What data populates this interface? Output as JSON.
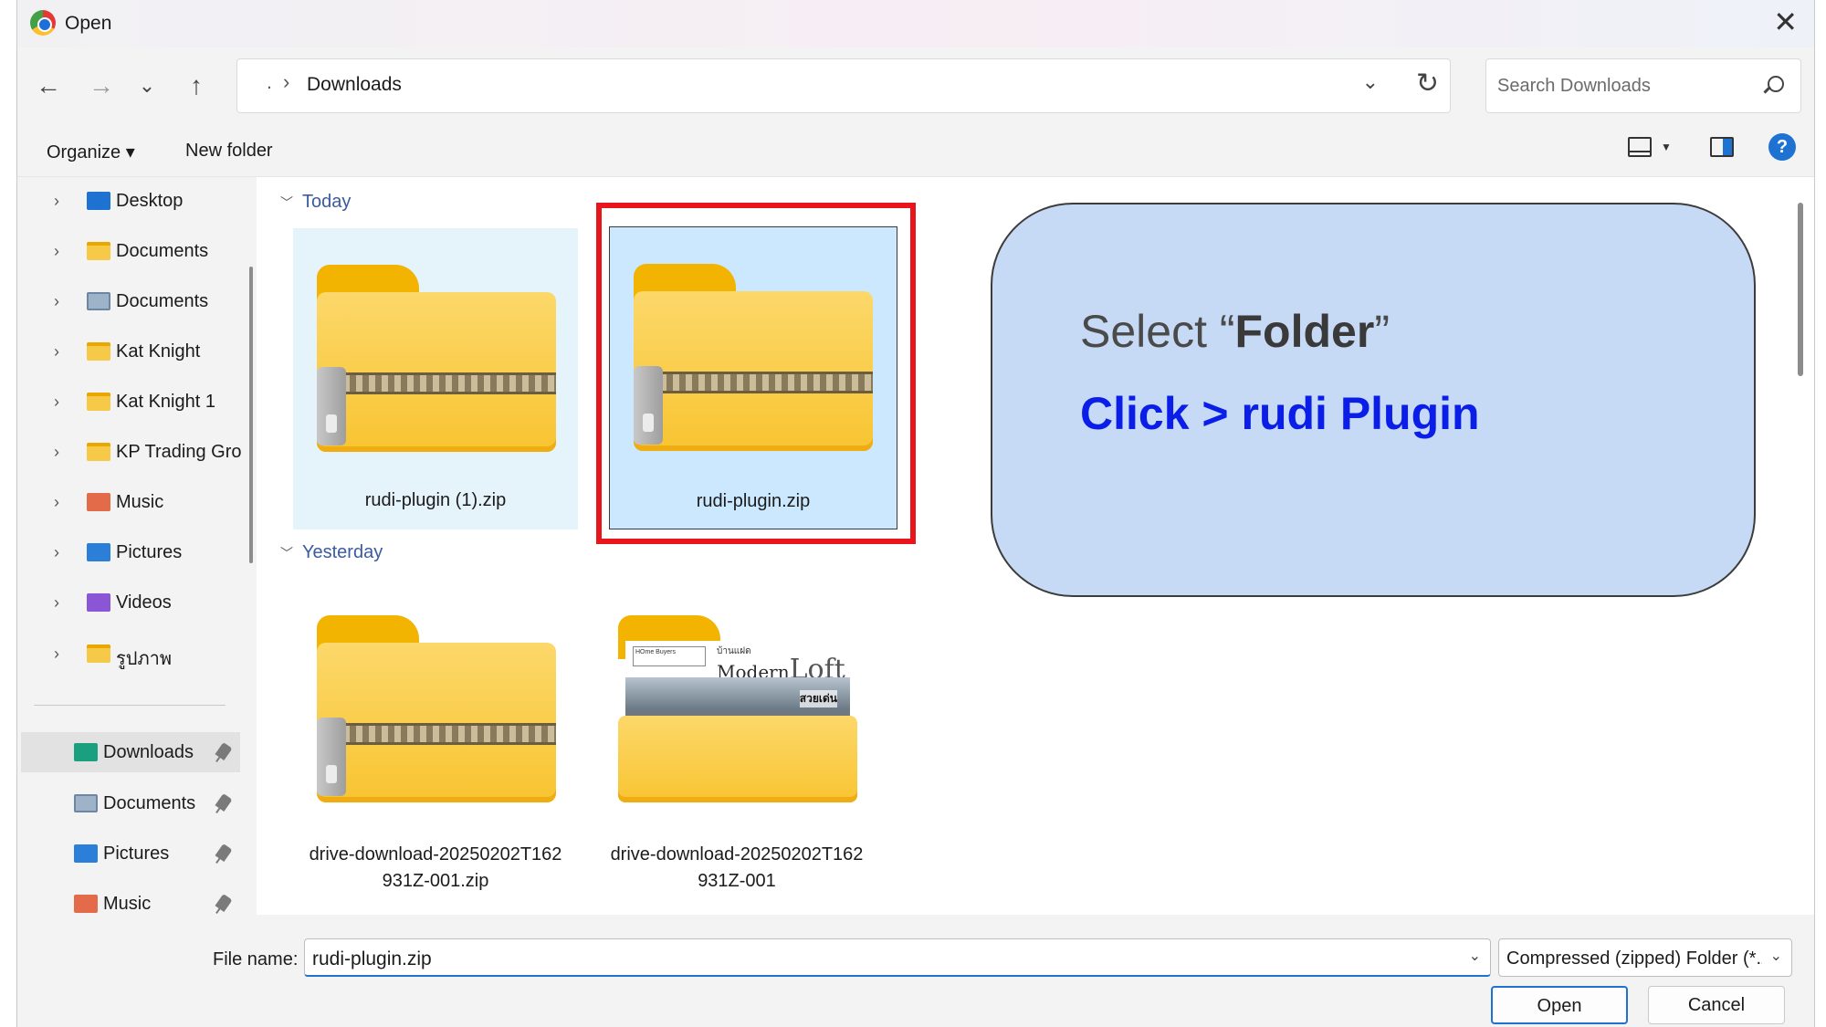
{
  "window": {
    "title": "Open"
  },
  "nav": {
    "back": "←",
    "forward": "→",
    "recent": "⌄",
    "up": "↑",
    "address_root": ".",
    "address_sep": "›",
    "address_current": "Downloads",
    "address_dropdown": "⌄",
    "refresh": "↻",
    "search_placeholder": "Search Downloads"
  },
  "command_bar": {
    "organize": "Organize ▾",
    "new_folder": "New folder",
    "help": "?"
  },
  "sidebar": {
    "items": [
      {
        "label": "Desktop",
        "icon": "desktop-folder-icon"
      },
      {
        "label": "Documents",
        "icon": "folder-icon"
      },
      {
        "label": "Documents",
        "icon": "documents-icon"
      },
      {
        "label": "Kat Knight",
        "icon": "folder-icon"
      },
      {
        "label": "Kat Knight 1",
        "icon": "folder-icon"
      },
      {
        "label": "KP Trading Gro",
        "icon": "folder-icon"
      },
      {
        "label": "Music",
        "icon": "music-icon"
      },
      {
        "label": "Pictures",
        "icon": "pictures-icon"
      },
      {
        "label": "Videos",
        "icon": "videos-icon"
      },
      {
        "label": "รูปภาพ",
        "icon": "folder-icon"
      }
    ],
    "quick_access": [
      {
        "label": "Downloads",
        "icon": "downloads-icon",
        "selected": true
      },
      {
        "label": "Documents",
        "icon": "documents-icon"
      },
      {
        "label": "Pictures",
        "icon": "pictures-icon"
      },
      {
        "label": "Music",
        "icon": "music-icon"
      }
    ]
  },
  "content": {
    "groups": [
      {
        "header": "Today",
        "files": [
          "rudi-plugin (1).zip",
          "rudi-plugin.zip"
        ]
      },
      {
        "header": "Yesterday",
        "files": [
          "drive-download-20250202T162931Z-001.zip",
          "drive-download-20250202T162931Z-001"
        ]
      }
    ],
    "tile_names": {
      "f1": "rudi-plugin (1).zip",
      "f2": "rudi-plugin.zip",
      "f3_l1": "drive-download-20250202T162",
      "f3_l2": "931Z-001.zip",
      "f4_l1": "drive-download-20250202T162",
      "f4_l2": "931Z-001"
    },
    "thumbnail": {
      "logo_text": "HOme Buyers",
      "subtitle": "บ้านแฝด",
      "title_a": "Modern",
      "title_b": "Loft",
      "tag": "สวยเด่น"
    }
  },
  "callout": {
    "line1_prefix": "Select “",
    "line1_bold": "Folder",
    "line1_suffix": "”",
    "line2": "Click > rudi Plugin"
  },
  "footer": {
    "file_name_label": "File name:",
    "file_name_value": "rudi-plugin.zip",
    "file_type_value": "Compressed (zipped) Folder (*.z",
    "open_label": "Open",
    "cancel_label": "Cancel"
  },
  "colors": {
    "accent": "#1e73d2",
    "highlight": "#e8161c",
    "callout_bg": "#c6d9f5",
    "callout_text": "#0a1ee8"
  }
}
